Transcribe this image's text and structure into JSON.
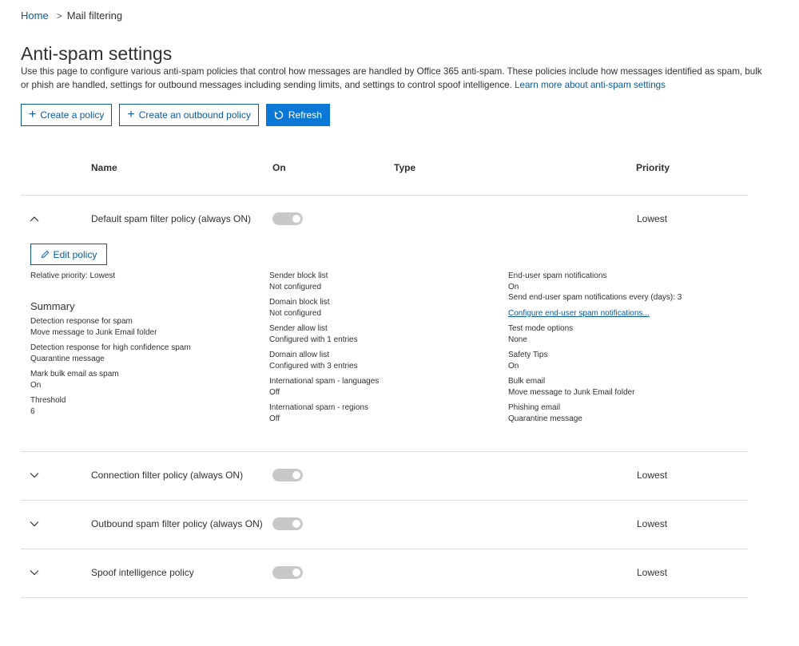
{
  "breadcrumb": {
    "home": "Home",
    "separator": ">",
    "current": "Mail filtering"
  },
  "page": {
    "title": "Anti-spam settings",
    "description": "Use this page to configure various anti-spam policies that control how messages are handled by Office 365 anti-spam. These policies include how messages identified as spam, bulk or phish are handled, settings for outbound messages including sending limits, and settings to control spoof intelligence.",
    "learn_more": "Learn more about anti-spam settings"
  },
  "toolbar": {
    "create_policy": "Create a policy",
    "create_outbound": "Create an outbound policy",
    "refresh": "Refresh"
  },
  "table": {
    "columns": {
      "name": "Name",
      "on": "On",
      "type": "Type",
      "priority": "Priority"
    },
    "rows": [
      {
        "name": "Default spam filter policy (always ON)",
        "priority": "Lowest",
        "expanded": true,
        "on": true
      },
      {
        "name": "Connection filter policy (always ON)",
        "priority": "Lowest",
        "expanded": false,
        "on": true
      },
      {
        "name": "Outbound spam filter policy (always ON)",
        "priority": "Lowest",
        "expanded": false,
        "on": true
      },
      {
        "name": "Spoof intelligence policy",
        "priority": "Lowest",
        "expanded": false,
        "on": true
      }
    ]
  },
  "detail": {
    "edit_policy": "Edit policy",
    "relative_priority": "Relative priority: Lowest",
    "summary_title": "Summary",
    "col1": [
      {
        "label": "Detection response for spam",
        "value": "Move message to Junk Email folder"
      },
      {
        "label": "Detection response for high confidence spam",
        "value": "Quarantine message"
      },
      {
        "label": "Mark bulk email as spam",
        "value": "On"
      },
      {
        "label": "Threshold",
        "value": "6"
      }
    ],
    "col2": [
      {
        "label": "Sender block list",
        "value": "Not configured"
      },
      {
        "label": "Domain block list",
        "value": "Not configured"
      },
      {
        "label": "Sender allow list",
        "value": "Configured with 1 entries"
      },
      {
        "label": "Domain allow list",
        "value": "Configured with 3 entries"
      },
      {
        "label": "International spam - languages",
        "value": "Off"
      },
      {
        "label": "International spam - regions",
        "value": "Off"
      }
    ],
    "col3_top": {
      "label": "End-user spam notifications",
      "value": "On",
      "extra": "Send end-user spam notifications every (days): 3"
    },
    "col3_link": "Configure end-user spam notifications...",
    "col3": [
      {
        "label": "Test mode options",
        "value": "None"
      },
      {
        "label": "Safety Tips",
        "value": "On"
      },
      {
        "label": "Bulk email",
        "value": "Move message to Junk Email folder"
      },
      {
        "label": "Phishing email",
        "value": "Quarantine message"
      }
    ]
  },
  "colors": {
    "accent": "#0a78d4",
    "link": "#0a5a9c",
    "toggle_off": "#c8c8c8"
  }
}
